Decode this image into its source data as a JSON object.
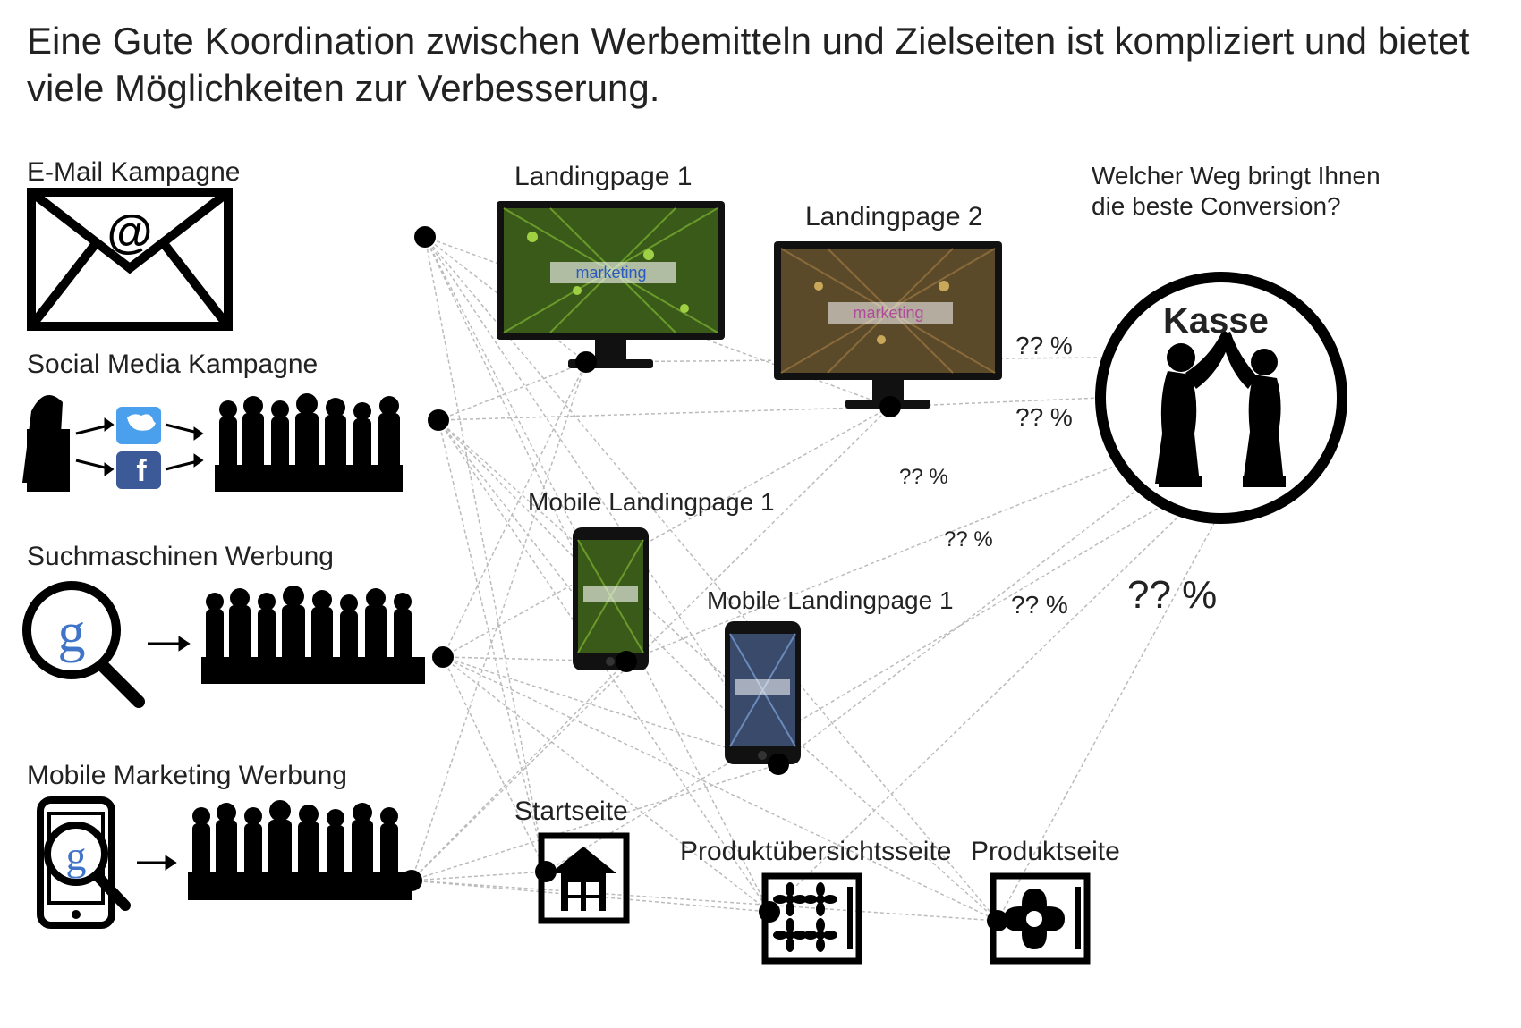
{
  "title": "Eine Gute Koordination zwischen Werbemitteln und Zielseiten ist kompliziert und bietet viele Möglichkeiten zur Verbesserung.",
  "sources": {
    "email": "E-Mail Kampagne",
    "social": "Social Media Kampagne",
    "search": "Suchmaschinen Werbung",
    "mobile": "Mobile Marketing Werbung"
  },
  "targets": {
    "lp1": "Landingpage 1",
    "lp2": "Landingpage 2",
    "mlp1": "Mobile Landingpage 1",
    "mlp2": "Mobile Landingpage 1",
    "start": "Startseite",
    "overview": "Produktübersichtsseite",
    "product": "Produktseite"
  },
  "goal": {
    "question": "Welcher Weg bringt Ihnen die beste Conversion?",
    "label": "Kasse"
  },
  "conversion": {
    "unknown": "?? %"
  }
}
